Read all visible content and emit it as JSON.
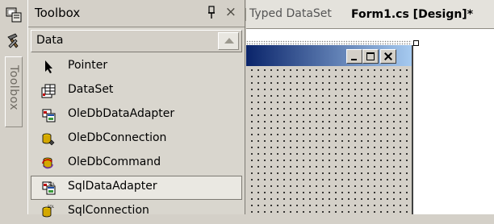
{
  "toolbox": {
    "title": "Toolbox",
    "pin_glyph": "↕",
    "close_glyph": "×",
    "category": "Data",
    "items": [
      {
        "label": "Pointer",
        "icon": "pointer-icon"
      },
      {
        "label": "DataSet",
        "icon": "dataset-icon"
      },
      {
        "label": "OleDbDataAdapter",
        "icon": "oledb-data-adapter-icon"
      },
      {
        "label": "OleDbConnection",
        "icon": "oledb-connection-icon"
      },
      {
        "label": "OleDbCommand",
        "icon": "oledb-command-icon"
      },
      {
        "label": "SqlDataAdapter",
        "icon": "sql-data-adapter-icon"
      },
      {
        "label": "SqlConnection",
        "icon": "sql-connection-icon"
      }
    ],
    "selected_index": 5
  },
  "side_strip": {
    "vertical_tab_label": "Toolbox"
  },
  "tabs": {
    "typed_dataset": "Typed DataSet",
    "form_design": "Form1.cs [Design]*"
  },
  "colors": {
    "titlebar_start": "#0a246a",
    "titlebar_end": "#a6caf0",
    "panel_bg": "#d4d0c8"
  }
}
